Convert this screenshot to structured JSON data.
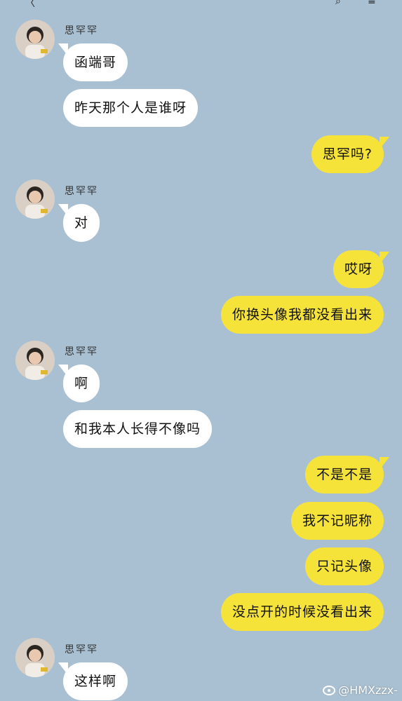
{
  "top_bar": {
    "back_glyph": "〈",
    "title_fragment": "",
    "search_glyph": "⌕",
    "menu_glyph": "≡"
  },
  "contact": {
    "name": "思罕罕"
  },
  "messages": [
    {
      "side": "in",
      "text": "函端哥"
    },
    {
      "side": "in",
      "text": "昨天那个人是谁呀"
    },
    {
      "side": "out",
      "text": "思罕吗?"
    },
    {
      "side": "in",
      "text": "对"
    },
    {
      "side": "out",
      "text": "哎呀"
    },
    {
      "side": "out",
      "text": "你换头像我都没看出来"
    },
    {
      "side": "in",
      "text": "啊"
    },
    {
      "side": "in",
      "text": "和我本人长得不像吗"
    },
    {
      "side": "out",
      "text": "不是不是"
    },
    {
      "side": "out",
      "text": "我不记昵称"
    },
    {
      "side": "out",
      "text": "只记头像"
    },
    {
      "side": "out",
      "text": "没点开的时候没看出来"
    },
    {
      "side": "in",
      "text": "这样啊"
    }
  ],
  "watermark": {
    "text": "@HMXzzx-"
  },
  "colors": {
    "background": "#a9c0d3",
    "incoming": "#ffffff",
    "outgoing": "#f6e33a"
  }
}
